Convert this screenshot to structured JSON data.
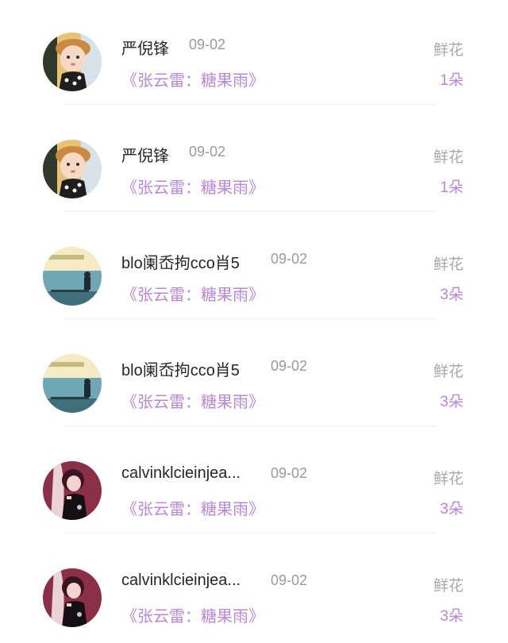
{
  "list": {
    "items": [
      {
        "name": "严倪锋",
        "date": "09-02",
        "song": "《张云雷：糖果雨》",
        "gift_label": "鲜花",
        "gift_count": "1朵",
        "avatar": "child-photo-avatar"
      },
      {
        "name": "严倪锋",
        "date": "09-02",
        "song": "《张云雷：糖果雨》",
        "gift_label": "鲜花",
        "gift_count": "1朵",
        "avatar": "child-photo-avatar"
      },
      {
        "name": "blo阑岙拘cco肖5",
        "date": "09-02",
        "song": "《张云雷：糖果雨》",
        "gift_label": "鲜花",
        "gift_count": "3朵",
        "avatar": "seaside-photo-avatar"
      },
      {
        "name": "blo阑岙拘cco肖5",
        "date": "09-02",
        "song": "《张云雷：糖果雨》",
        "gift_label": "鲜花",
        "gift_count": "3朵",
        "avatar": "seaside-photo-avatar"
      },
      {
        "name": "calvinklcieinjea...",
        "date": "09-02",
        "song": "《张云雷：糖果雨》",
        "gift_label": "鲜花",
        "gift_count": "3朵",
        "avatar": "illustrated-girl-avatar"
      },
      {
        "name": "calvinklcieinjea...",
        "date": "09-02",
        "song": "《张云雷：糖果雨》",
        "gift_label": "鲜花",
        "gift_count": "3朵",
        "avatar": "illustrated-girl-avatar"
      }
    ]
  },
  "colors": {
    "accent": "#b888d6",
    "name_text": "#262626",
    "muted_text": "#9a9a9a"
  }
}
